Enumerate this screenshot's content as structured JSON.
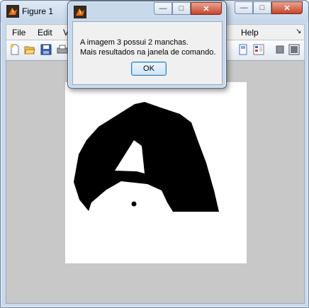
{
  "figure_window": {
    "title": "Figure 1",
    "caption_buttons": {
      "minimize": "—",
      "maximize": "□",
      "close": "✕"
    },
    "menu": [
      "File",
      "Edit",
      "V",
      "Help"
    ],
    "menu_overflow": "↘",
    "toolbar_icons": [
      "new-figure-icon",
      "open-file-icon",
      "save-icon",
      "print-icon",
      "data-cursor-icon",
      "colorbar-icon",
      "hide-plot-tools-icon",
      "show-plot-tools-icon"
    ]
  },
  "image": {
    "description_colors": {
      "foreground": "#000000",
      "background": "#ffffff"
    }
  },
  "dialog": {
    "caption_buttons": {
      "minimize": "—",
      "maximize": "□",
      "close": "✕"
    },
    "message_line1": "A imagem 3 possui 2 manchas.",
    "message_line2": "Mais resultados na janela de comando.",
    "ok_label": "OK"
  },
  "colors": {
    "frame": "#c9d9ec",
    "plot_bg": "#c8c8c8",
    "close_red": "#c7452a"
  }
}
